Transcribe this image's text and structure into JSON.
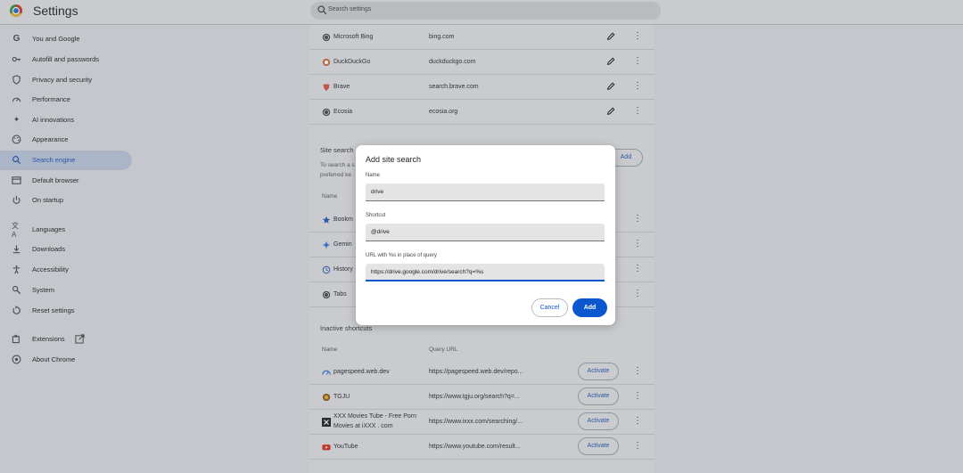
{
  "header": {
    "title": "Settings",
    "search_placeholder": "Search settings"
  },
  "sidebar": {
    "items": [
      {
        "label": "You and Google",
        "icon": "google-g-icon"
      },
      {
        "label": "Autofill and passwords",
        "icon": "key-icon"
      },
      {
        "label": "Privacy and security",
        "icon": "shield-icon"
      },
      {
        "label": "Performance",
        "icon": "speedometer-icon"
      },
      {
        "label": "AI innovations",
        "icon": "sparkle-icon"
      },
      {
        "label": "Appearance",
        "icon": "palette-icon"
      },
      {
        "label": "Search engine",
        "icon": "search-icon",
        "active": true
      },
      {
        "label": "Default browser",
        "icon": "browser-icon"
      },
      {
        "label": "On startup",
        "icon": "power-icon"
      },
      {
        "label": "Languages",
        "icon": "translate-icon"
      },
      {
        "label": "Downloads",
        "icon": "download-icon"
      },
      {
        "label": "Accessibility",
        "icon": "accessibility-icon"
      },
      {
        "label": "System",
        "icon": "wrench-icon"
      },
      {
        "label": "Reset settings",
        "icon": "reset-icon"
      },
      {
        "label": "Extensions",
        "icon": "puzzle-icon"
      },
      {
        "label": "About Chrome",
        "icon": "chrome-icon"
      }
    ]
  },
  "search_engines": [
    {
      "name": "Microsoft Bing",
      "url": "bing.com"
    },
    {
      "name": "DuckDuckGo",
      "url": "duckduckgo.com"
    },
    {
      "name": "Brave",
      "url": "search.brave.com"
    },
    {
      "name": "Ecosia",
      "url": "ecosia.org"
    }
  ],
  "site_search": {
    "title": "Site search",
    "desc_line1": "To search a s",
    "desc_line2": "preferred ke",
    "col_name": "Name",
    "add_label": "Add",
    "rows": [
      {
        "name": "Bookm"
      },
      {
        "name": "Gemin"
      },
      {
        "name": "History"
      },
      {
        "name": "Tabs"
      }
    ]
  },
  "inactive": {
    "title": "Inactive shortcuts",
    "col_name": "Name",
    "col_url": "Query URL",
    "activate_label": "Activate",
    "rows": [
      {
        "name": "pagespeed.web.dev",
        "url": "https://pagespeed.web.dev/repo..."
      },
      {
        "name": "TGJU",
        "url": "https://www.tgju.org/search?q=..."
      },
      {
        "name_line1": "XXX Movies Tube - Free Porn",
        "name_line2": "Movies at iXXX . com",
        "url": "https://www.ixxx.com/searching/..."
      },
      {
        "name": "YouTube",
        "url": "https://www.youtube.com/result..."
      }
    ]
  },
  "dialog": {
    "title": "Add site search",
    "name_label": "Name",
    "name_value": "drive",
    "shortcut_label": "Shortcut",
    "shortcut_value": "@drive",
    "url_label": "URL with %s in place of query",
    "url_value": "https://drive.google.com/drive/search?q=%s",
    "cancel_label": "Cancel",
    "add_label": "Add"
  },
  "colors": {
    "accent": "#0b57d0",
    "active_nav_bg": "#aab5c8",
    "scrim": "#c5c7cc"
  }
}
